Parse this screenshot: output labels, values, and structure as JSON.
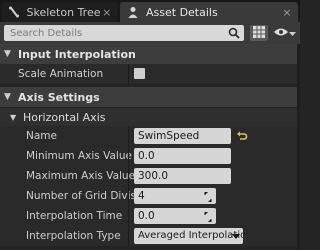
{
  "tabs": [
    {
      "label": "Skeleton Tree",
      "icon": "bone-icon",
      "close": "×"
    },
    {
      "label": "Asset Details",
      "icon": "person-icon",
      "close": "×"
    }
  ],
  "search": {
    "placeholder": "Search Details",
    "value": ""
  },
  "sections": {
    "input_interpolation": {
      "title": "Input Interpolation",
      "arrow": "▼"
    },
    "axis_settings": {
      "title": "Axis Settings",
      "arrow": "▼"
    },
    "horizontal_axis": {
      "title": "Horizontal Axis",
      "arrow": "▼"
    }
  },
  "properties": {
    "scale_animation": {
      "label": "Scale Animation",
      "checked": false
    },
    "name": {
      "label": "Name",
      "value": "SwimSpeed"
    },
    "min_axis": {
      "label": "Minimum Axis Value",
      "value": "0.0"
    },
    "max_axis": {
      "label": "Maximum Axis Value",
      "value": "300.0"
    },
    "grid_divisions": {
      "label": "Number of Grid Divisions",
      "value": "4"
    },
    "interp_time": {
      "label": "Interpolation Time",
      "value": "0.0"
    },
    "interp_type": {
      "label": "Interpolation Type",
      "value": "Averaged Interpolation"
    }
  },
  "colors": {
    "accent_reset": "#d6c35a",
    "panel": "#2a2a2a",
    "section": "#3d3d3d"
  }
}
